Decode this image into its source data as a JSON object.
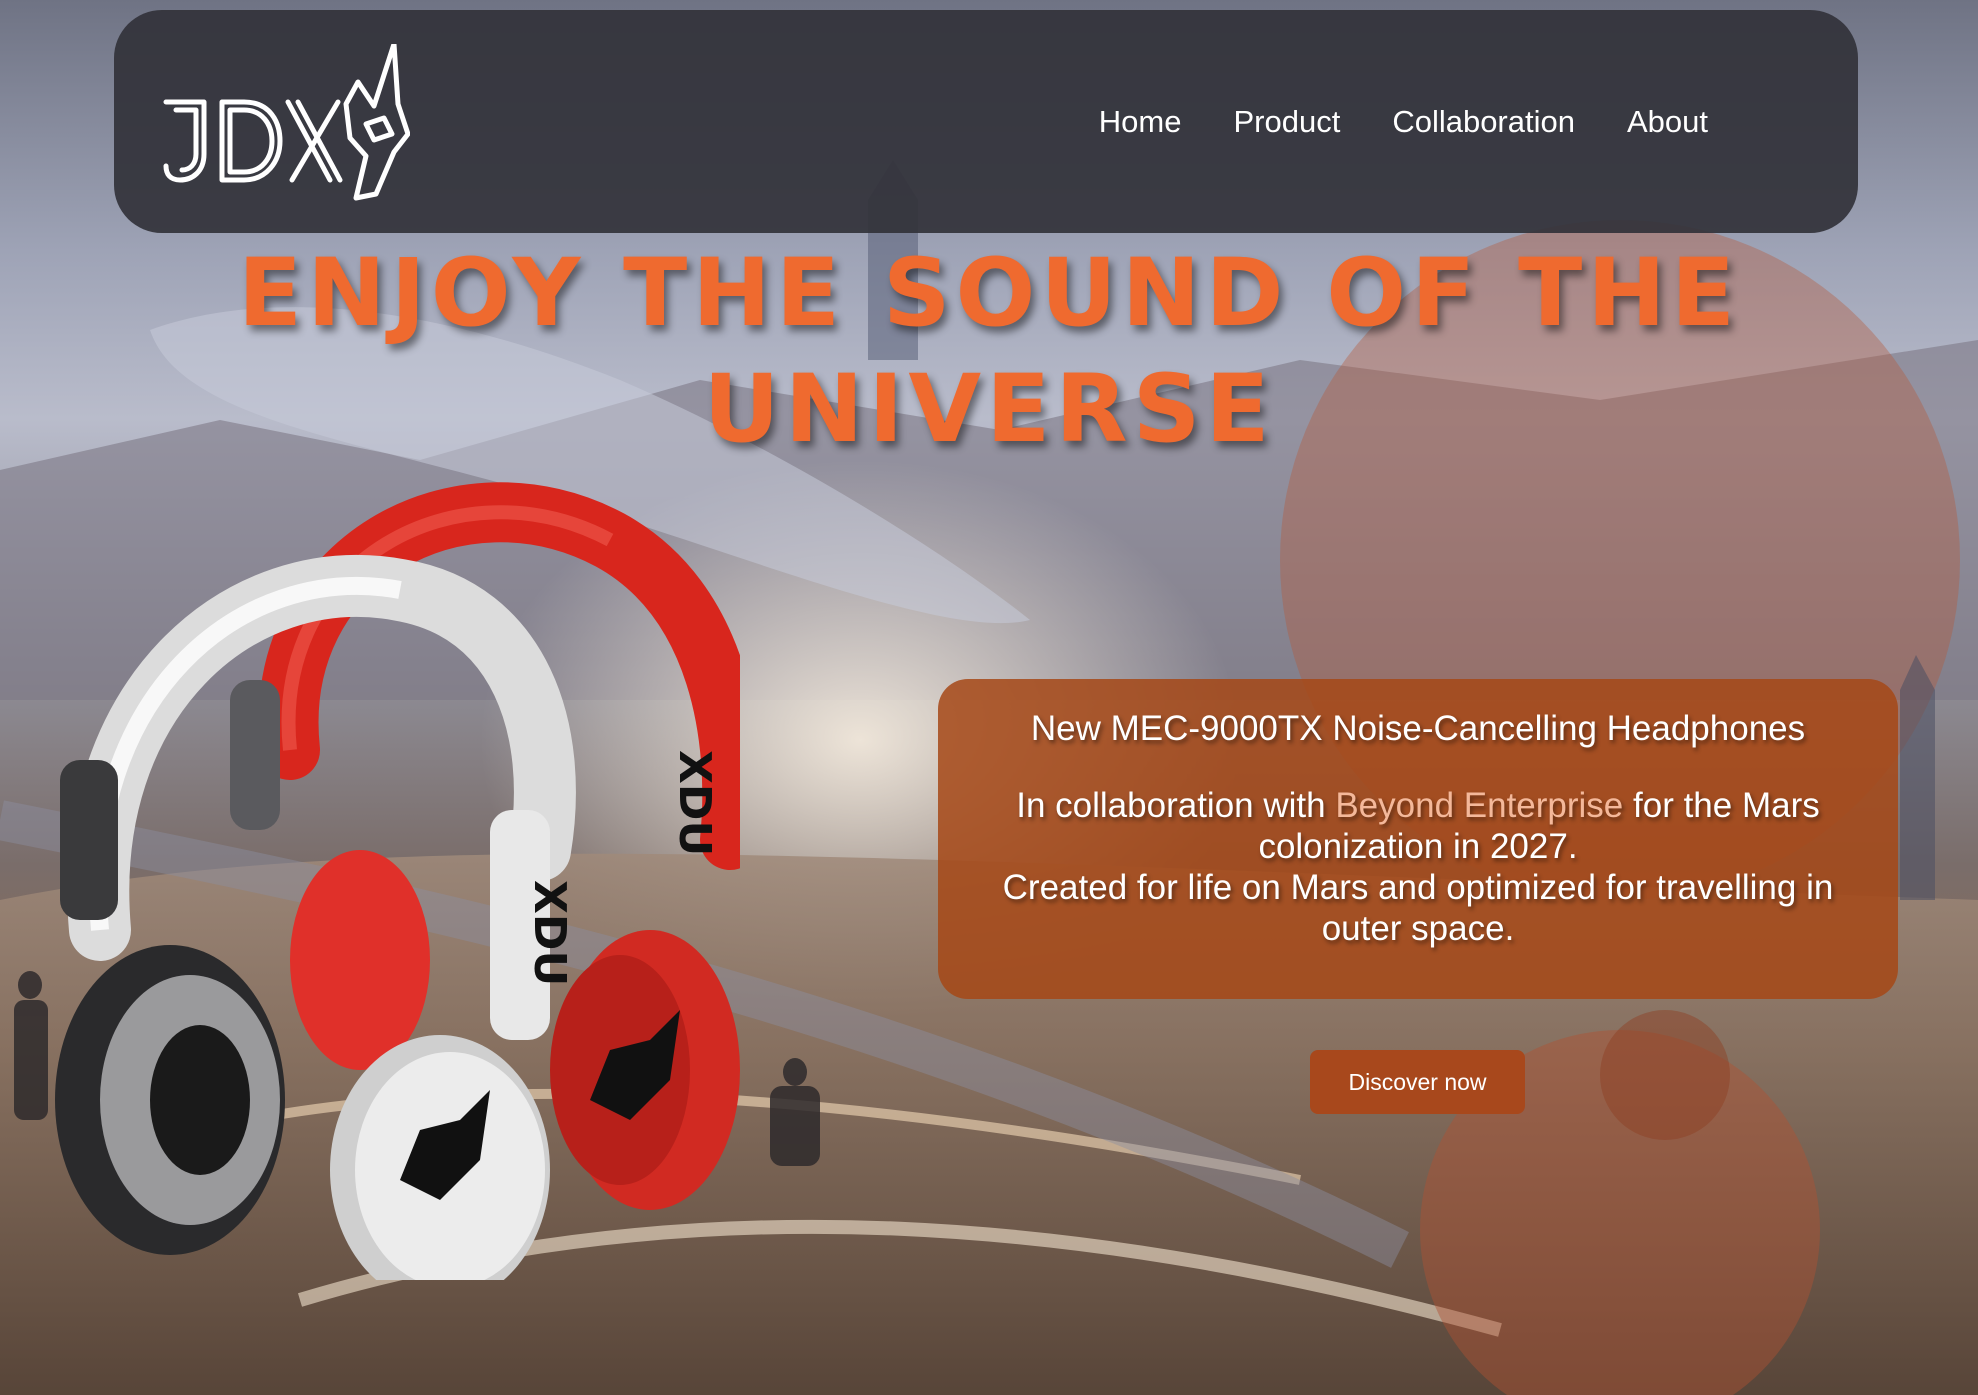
{
  "brand": {
    "logo_text": "JDX",
    "colors": {
      "accent_orange": "#ef6a2f",
      "card_orange": "#a6481c",
      "nav_dark": "#32323a",
      "link_peach": "#f4b89a"
    }
  },
  "nav": {
    "items": [
      {
        "label": "Home"
      },
      {
        "label": "Product"
      },
      {
        "label": "Collaboration"
      },
      {
        "label": "About"
      }
    ]
  },
  "hero": {
    "title_line1": "ENJOY THE SOUND OF THE",
    "title_line2": "UNIVERSE"
  },
  "card": {
    "heading": "New MEC-9000TX Noise-Cancelling Headphones",
    "text_before_link": "In collaboration with ",
    "link_text": "Beyond Enterprise",
    "text_after_link": " for the Mars colonization in 2027.",
    "text_line2": "Created for life on Mars and optimized for travelling in outer space."
  },
  "cta": {
    "label": "Discover now"
  },
  "product_image": {
    "headphone_brand_mark": "JDX"
  }
}
